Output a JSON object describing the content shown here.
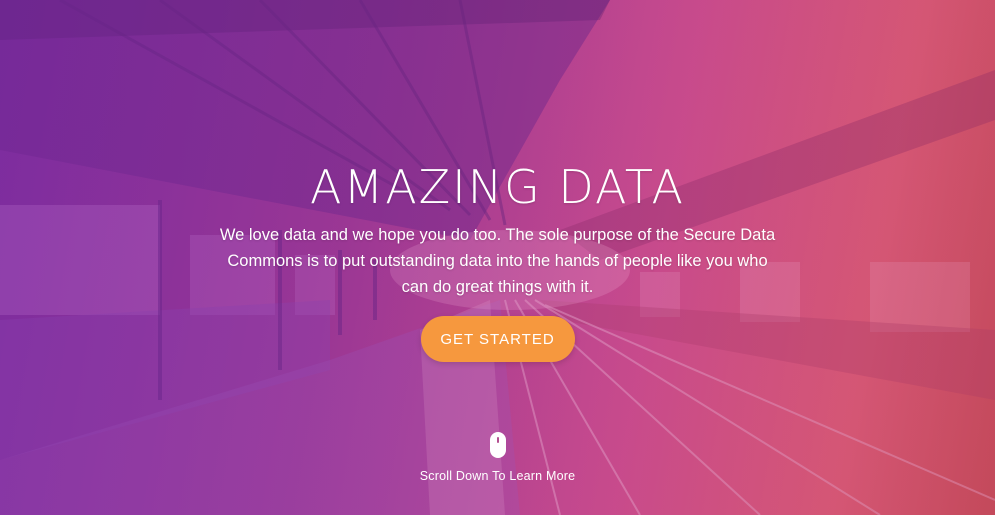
{
  "hero": {
    "title": "AMAZING DATA",
    "subtitle": "We love data and we hope you do too. The sole purpose of the Secure Data Commons is to put outstanding data into the hands of people like you who can do great things with it.",
    "cta_label": "GET STARTED",
    "scroll_label": "Scroll Down To Learn More",
    "background_image": "train platform with overlay",
    "colors": {
      "gradient_start": "#7a2a9a",
      "gradient_end": "#d85a7a",
      "cta_background": "#f6983e",
      "text": "#ffffff"
    }
  },
  "icons": {
    "scroll": "mouse-icon"
  }
}
